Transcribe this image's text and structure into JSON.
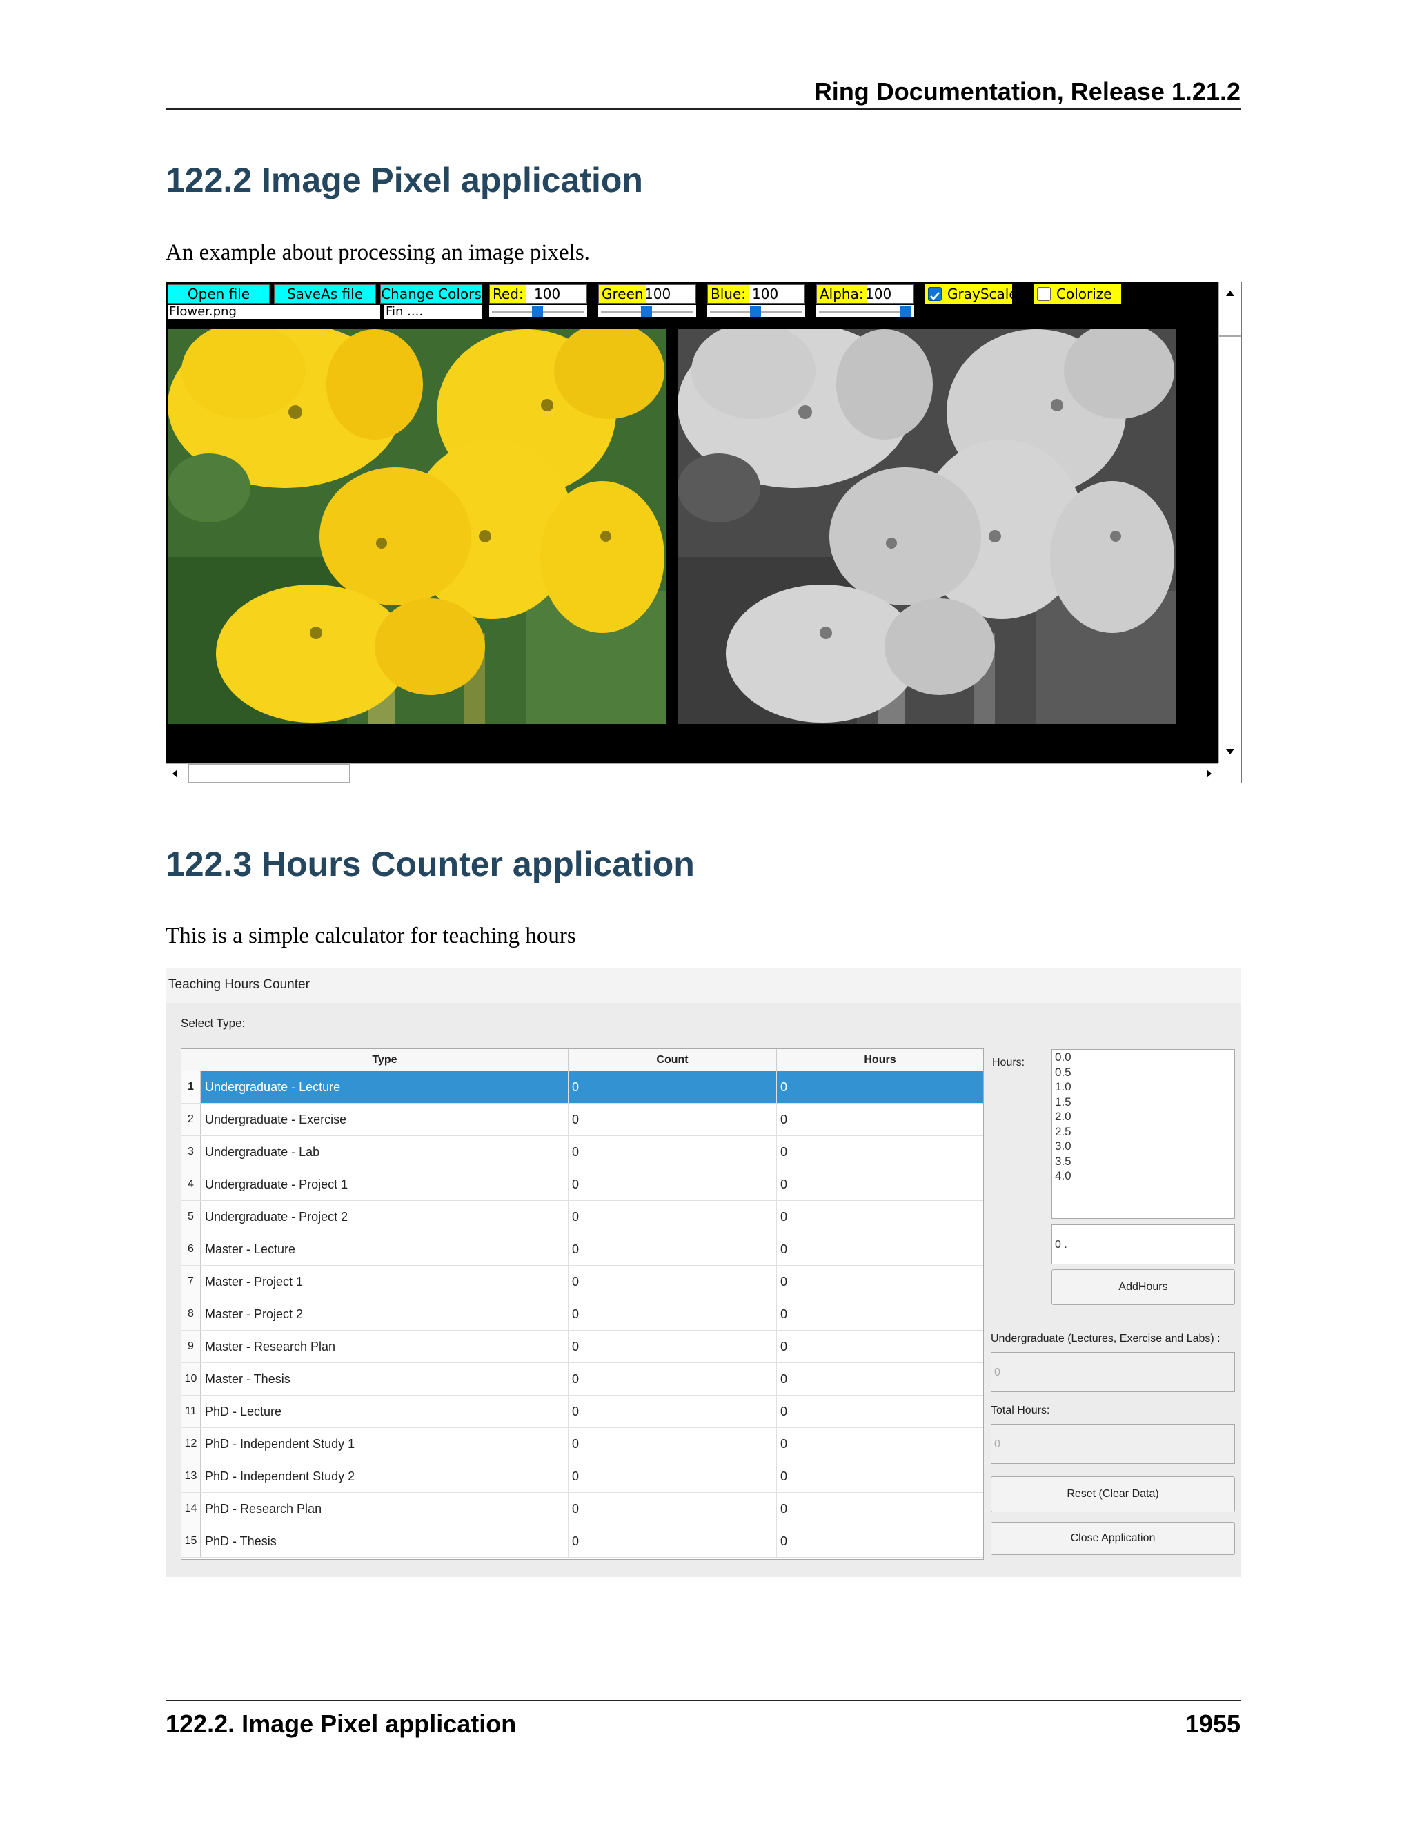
{
  "header": {
    "running_title": "Ring Documentation, Release 1.21.2"
  },
  "section1": {
    "title": "122.2  Image Pixel application",
    "intro": "An example about processing an image pixels."
  },
  "image_pixel_app": {
    "buttons": {
      "open": "Open file",
      "saveas": "SaveAs file",
      "change": "Change Colors"
    },
    "file_name": "Flower.png",
    "status": "Fin ....",
    "colors": [
      {
        "label": "Red:",
        "value": "100"
      },
      {
        "label": "Green",
        "value": "100"
      },
      {
        "label": "Blue:",
        "value": "100"
      },
      {
        "label": "Alpha:",
        "value": "100"
      }
    ],
    "grayscale_label": "GrayScale",
    "grayscale_checked": true,
    "colorize_label": "Colorize",
    "colorize_checked": false
  },
  "section2": {
    "title": "122.3  Hours Counter application",
    "intro": "This is a simple calculator for teaching hours"
  },
  "hours_app": {
    "window_title": "Teaching Hours Counter",
    "select_type_label": "Select Type:",
    "columns": [
      "Type",
      "Count",
      "Hours"
    ],
    "rows": [
      {
        "n": "1",
        "type": "Undergraduate - Lecture",
        "count": "0",
        "hours": "0"
      },
      {
        "n": "2",
        "type": "Undergraduate - Exercise",
        "count": "0",
        "hours": "0"
      },
      {
        "n": "3",
        "type": "Undergraduate - Lab",
        "count": "0",
        "hours": "0"
      },
      {
        "n": "4",
        "type": "Undergraduate - Project 1",
        "count": "0",
        "hours": "0"
      },
      {
        "n": "5",
        "type": "Undergraduate - Project 2",
        "count": "0",
        "hours": "0"
      },
      {
        "n": "6",
        "type": "Master - Lecture",
        "count": "0",
        "hours": "0"
      },
      {
        "n": "7",
        "type": "Master - Project 1",
        "count": "0",
        "hours": "0"
      },
      {
        "n": "8",
        "type": "Master - Project 2",
        "count": "0",
        "hours": "0"
      },
      {
        "n": "9",
        "type": "Master - Research Plan",
        "count": "0",
        "hours": "0"
      },
      {
        "n": "10",
        "type": "Master - Thesis",
        "count": "0",
        "hours": "0"
      },
      {
        "n": "11",
        "type": "PhD - Lecture",
        "count": "0",
        "hours": "0"
      },
      {
        "n": "12",
        "type": "PhD - Independent Study 1",
        "count": "0",
        "hours": "0"
      },
      {
        "n": "13",
        "type": "PhD - Independent Study 2",
        "count": "0",
        "hours": "0"
      },
      {
        "n": "14",
        "type": "PhD - Research Plan",
        "count": "0",
        "hours": "0"
      },
      {
        "n": "15",
        "type": "PhD - Thesis",
        "count": "0",
        "hours": "0"
      }
    ],
    "selected_row": 1,
    "hours_label": "Hours:",
    "hours_options": [
      "0.0",
      "0.5",
      "1.0",
      "1.5",
      "2.0",
      "2.5",
      "3.0",
      "3.5",
      "4.0"
    ],
    "hours_input_value": "0 .",
    "add_hours_button": "AddHours",
    "undergrad_label": "Undergraduate (Lectures, Exercise and Labs) :",
    "undergrad_value": "0",
    "total_label": "Total Hours:",
    "total_value": "0",
    "reset_button": "Reset (Clear Data)",
    "close_button": "Close Application"
  },
  "footer": {
    "section_ref": "122.2.  Image Pixel application",
    "page_number": "1955"
  }
}
